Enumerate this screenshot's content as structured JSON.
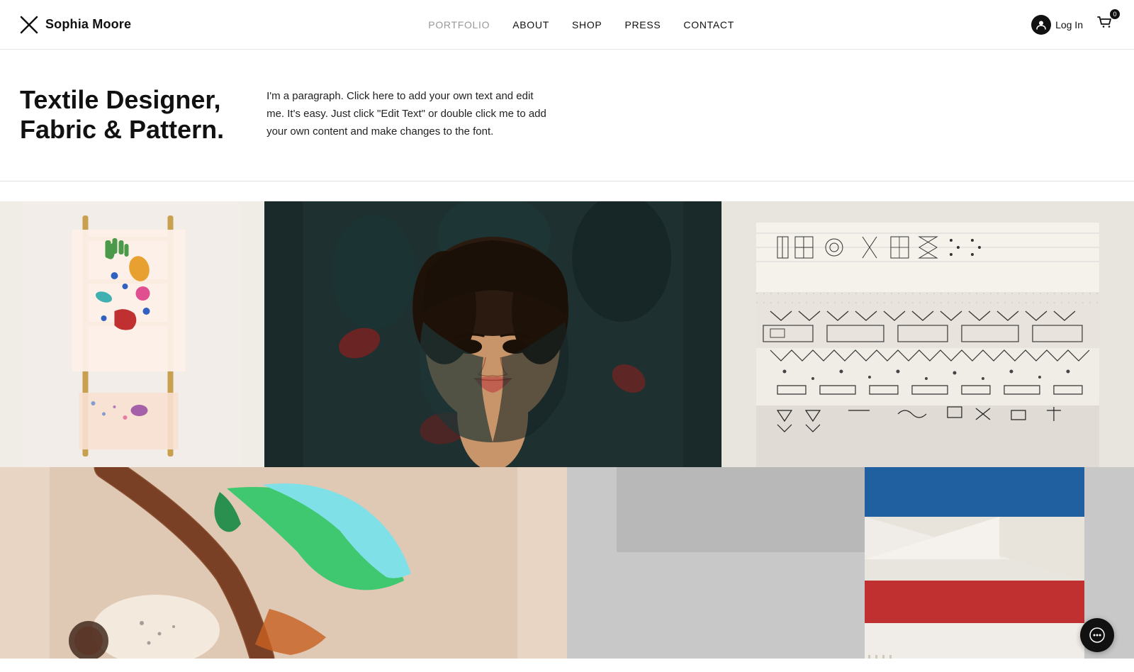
{
  "site": {
    "logo_text": "Sophia Moore",
    "logo_icon": "✕"
  },
  "nav": {
    "items": [
      {
        "label": "PORTFOLIO",
        "active": true,
        "id": "portfolio"
      },
      {
        "label": "ABOUT",
        "active": false,
        "id": "about"
      },
      {
        "label": "SHOP",
        "active": false,
        "id": "shop"
      },
      {
        "label": "PRESS",
        "active": false,
        "id": "press"
      },
      {
        "label": "CONTACT",
        "active": false,
        "id": "contact"
      }
    ],
    "login_label": "Log In",
    "cart_count": "0"
  },
  "hero": {
    "title_line1": "Textile Designer,",
    "title_line2": "Fabric & Pattern.",
    "description": "I'm a paragraph. Click here to add your own text and edit me. It's easy. Just click \"Edit Text\" or double click me to add your own content and make changes to the font."
  },
  "gallery": {
    "top_row": [
      {
        "id": "gallery-1",
        "alt": "Colorful textile art on wooden ladder",
        "type": "textile-ladder"
      },
      {
        "id": "gallery-2",
        "alt": "Woman wrapped in dark floral fabric",
        "type": "portrait"
      },
      {
        "id": "gallery-3",
        "alt": "Stacked white patterned fabrics",
        "type": "stacked-fabric"
      }
    ],
    "bottom_row": [
      {
        "id": "gallery-4",
        "alt": "Silk scarf with colorful pattern",
        "type": "silk-scarf"
      },
      {
        "id": "gallery-5",
        "alt": "Striped blanket on grey wall",
        "type": "striped-blanket"
      }
    ]
  },
  "chat": {
    "icon": "💬",
    "label": "Chat"
  }
}
